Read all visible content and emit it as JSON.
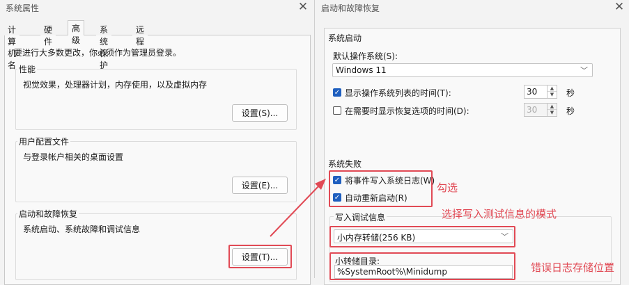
{
  "left_window": {
    "title": "系统属性",
    "tabs": [
      "计算机名",
      "硬件",
      "高级",
      "系统保护",
      "远程"
    ],
    "active_tab": "高级",
    "admin_note": "要进行大多数更改，你必须作为管理员登录。",
    "groups": {
      "performance": {
        "title": "性能",
        "desc": "视觉效果，处理器计划，内存使用，以及虚拟内存",
        "button": "设置(S)..."
      },
      "user_profiles": {
        "title": "用户配置文件",
        "desc": "与登录帐户相关的桌面设置",
        "button": "设置(E)..."
      },
      "startup_recovery": {
        "title": "启动和故障恢复",
        "desc": "系统启动、系统故障和调试信息",
        "button": "设置(T)..."
      }
    }
  },
  "right_window": {
    "title": "启动和故障恢复",
    "system_startup": {
      "label": "系统启动",
      "default_os_label": "默认操作系统(S):",
      "default_os_value": "Windows 11",
      "show_list_label": "显示操作系统列表的时间(T):",
      "show_list_checked": true,
      "show_list_value": "30",
      "show_recovery_label": "在需要时显示恢复选项的时间(D):",
      "show_recovery_checked": false,
      "show_recovery_value": "30",
      "seconds_unit": "秒"
    },
    "system_failure": {
      "label": "系统失败",
      "write_event_label": "将事件写入系统日志(W)",
      "write_event_checked": true,
      "auto_restart_label": "自动重新启动(R)",
      "auto_restart_checked": true,
      "debug_info_label": "写入调试信息",
      "debug_info_value": "小内存转储(256 KB)",
      "dump_dir_label": "小转储目录:",
      "dump_dir_value": "%SystemRoot%\\Minidump"
    }
  },
  "annotations": {
    "check_note": "勾选",
    "mode_note": "选择写入测试信息的模式",
    "location_note": "错误日志存储位置",
    "color": "#e14a55"
  },
  "icons": {
    "close": "close-icon",
    "dropdown": "chevron-down-icon",
    "check": "check-icon"
  }
}
